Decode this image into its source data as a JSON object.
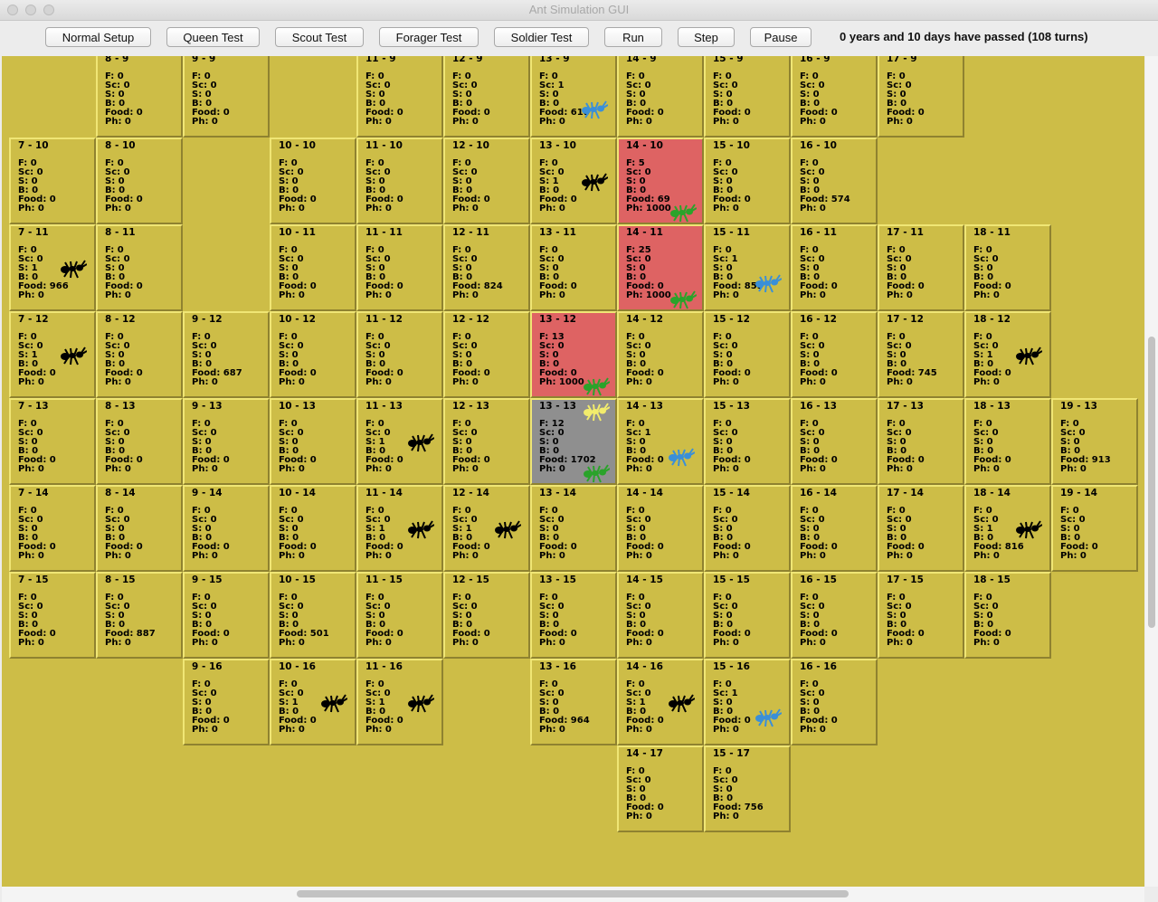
{
  "window": {
    "title": "Ant Simulation GUI"
  },
  "toolbar": {
    "buttons": [
      "Normal Setup",
      "Queen Test",
      "Scout Test",
      "Forager Test",
      "Soldier Test",
      "Run",
      "Step",
      "Pause"
    ],
    "status": "0 years and 10 days have passed (108 turns)"
  },
  "colors": {
    "board": "#cdbd47",
    "pheromone_cell": "#de6363",
    "colony_cell": "#8f8f8f",
    "soldier_ant": "#000000",
    "forager_ant": "#2aa32a",
    "scout_ant": "#3a8fd8",
    "queen_ant": "#f2ec6c"
  },
  "stat_labels": [
    "F: ",
    "Sc: ",
    "S: ",
    "B: ",
    "Food: ",
    "Ph: "
  ],
  "cells": [
    {
      "x": 8,
      "y": 9,
      "f": 0,
      "sc": 0,
      "s": 0,
      "b": 0,
      "food": 0,
      "ph": 0
    },
    {
      "x": 9,
      "y": 9,
      "f": 0,
      "sc": 0,
      "s": 0,
      "b": 0,
      "food": 0,
      "ph": 0
    },
    {
      "x": 11,
      "y": 9,
      "f": 0,
      "sc": 0,
      "s": 0,
      "b": 0,
      "food": 0,
      "ph": 0
    },
    {
      "x": 12,
      "y": 9,
      "f": 0,
      "sc": 0,
      "s": 0,
      "b": 0,
      "food": 0,
      "ph": 0
    },
    {
      "x": 13,
      "y": 9,
      "f": 0,
      "sc": 1,
      "s": 0,
      "b": 0,
      "food": 618,
      "ph": 0,
      "ants": [
        "scout"
      ]
    },
    {
      "x": 14,
      "y": 9,
      "f": 0,
      "sc": 0,
      "s": 0,
      "b": 0,
      "food": 0,
      "ph": 0
    },
    {
      "x": 15,
      "y": 9,
      "f": 0,
      "sc": 0,
      "s": 0,
      "b": 0,
      "food": 0,
      "ph": 0
    },
    {
      "x": 16,
      "y": 9,
      "f": 0,
      "sc": 0,
      "s": 0,
      "b": 0,
      "food": 0,
      "ph": 0
    },
    {
      "x": 17,
      "y": 9,
      "f": 0,
      "sc": 0,
      "s": 0,
      "b": 0,
      "food": 0,
      "ph": 0
    },
    {
      "x": 7,
      "y": 10,
      "f": 0,
      "sc": 0,
      "s": 0,
      "b": 0,
      "food": 0,
      "ph": 0
    },
    {
      "x": 8,
      "y": 10,
      "f": 0,
      "sc": 0,
      "s": 0,
      "b": 0,
      "food": 0,
      "ph": 0
    },
    {
      "x": 10,
      "y": 10,
      "f": 0,
      "sc": 0,
      "s": 0,
      "b": 0,
      "food": 0,
      "ph": 0
    },
    {
      "x": 11,
      "y": 10,
      "f": 0,
      "sc": 0,
      "s": 0,
      "b": 0,
      "food": 0,
      "ph": 0
    },
    {
      "x": 12,
      "y": 10,
      "f": 0,
      "sc": 0,
      "s": 0,
      "b": 0,
      "food": 0,
      "ph": 0
    },
    {
      "x": 13,
      "y": 10,
      "f": 0,
      "sc": 0,
      "s": 1,
      "b": 0,
      "food": 0,
      "ph": 0,
      "ants": [
        "soldier"
      ]
    },
    {
      "x": 14,
      "y": 10,
      "f": 5,
      "sc": 0,
      "s": 0,
      "b": 0,
      "food": 69,
      "ph": 1000,
      "ants": [
        "forager"
      ],
      "state": "hot"
    },
    {
      "x": 15,
      "y": 10,
      "f": 0,
      "sc": 0,
      "s": 0,
      "b": 0,
      "food": 0,
      "ph": 0
    },
    {
      "x": 16,
      "y": 10,
      "f": 0,
      "sc": 0,
      "s": 0,
      "b": 0,
      "food": 574,
      "ph": 0
    },
    {
      "x": 7,
      "y": 11,
      "f": 0,
      "sc": 0,
      "s": 1,
      "b": 0,
      "food": 966,
      "ph": 0,
      "ants": [
        "soldier"
      ]
    },
    {
      "x": 8,
      "y": 11,
      "f": 0,
      "sc": 0,
      "s": 0,
      "b": 0,
      "food": 0,
      "ph": 0
    },
    {
      "x": 10,
      "y": 11,
      "f": 0,
      "sc": 0,
      "s": 0,
      "b": 0,
      "food": 0,
      "ph": 0
    },
    {
      "x": 11,
      "y": 11,
      "f": 0,
      "sc": 0,
      "s": 0,
      "b": 0,
      "food": 0,
      "ph": 0
    },
    {
      "x": 12,
      "y": 11,
      "f": 0,
      "sc": 0,
      "s": 0,
      "b": 0,
      "food": 824,
      "ph": 0
    },
    {
      "x": 13,
      "y": 11,
      "f": 0,
      "sc": 0,
      "s": 0,
      "b": 0,
      "food": 0,
      "ph": 0
    },
    {
      "x": 14,
      "y": 11,
      "f": 25,
      "sc": 0,
      "s": 0,
      "b": 0,
      "food": 0,
      "ph": 1000,
      "ants": [
        "forager"
      ],
      "state": "hot"
    },
    {
      "x": 15,
      "y": 11,
      "f": 0,
      "sc": 1,
      "s": 0,
      "b": 0,
      "food": 855,
      "ph": 0,
      "ants": [
        "scout"
      ]
    },
    {
      "x": 16,
      "y": 11,
      "f": 0,
      "sc": 0,
      "s": 0,
      "b": 0,
      "food": 0,
      "ph": 0
    },
    {
      "x": 17,
      "y": 11,
      "f": 0,
      "sc": 0,
      "s": 0,
      "b": 0,
      "food": 0,
      "ph": 0
    },
    {
      "x": 18,
      "y": 11,
      "f": 0,
      "sc": 0,
      "s": 0,
      "b": 0,
      "food": 0,
      "ph": 0
    },
    {
      "x": 7,
      "y": 12,
      "f": 0,
      "sc": 0,
      "s": 1,
      "b": 0,
      "food": 0,
      "ph": 0,
      "ants": [
        "soldier"
      ]
    },
    {
      "x": 8,
      "y": 12,
      "f": 0,
      "sc": 0,
      "s": 0,
      "b": 0,
      "food": 0,
      "ph": 0
    },
    {
      "x": 9,
      "y": 12,
      "f": 0,
      "sc": 0,
      "s": 0,
      "b": 0,
      "food": 687,
      "ph": 0
    },
    {
      "x": 10,
      "y": 12,
      "f": 0,
      "sc": 0,
      "s": 0,
      "b": 0,
      "food": 0,
      "ph": 0
    },
    {
      "x": 11,
      "y": 12,
      "f": 0,
      "sc": 0,
      "s": 0,
      "b": 0,
      "food": 0,
      "ph": 0
    },
    {
      "x": 12,
      "y": 12,
      "f": 0,
      "sc": 0,
      "s": 0,
      "b": 0,
      "food": 0,
      "ph": 0
    },
    {
      "x": 13,
      "y": 12,
      "f": 13,
      "sc": 0,
      "s": 0,
      "b": 0,
      "food": 0,
      "ph": 1000,
      "ants": [
        "forager"
      ],
      "state": "hot"
    },
    {
      "x": 14,
      "y": 12,
      "f": 0,
      "sc": 0,
      "s": 0,
      "b": 0,
      "food": 0,
      "ph": 0
    },
    {
      "x": 15,
      "y": 12,
      "f": 0,
      "sc": 0,
      "s": 0,
      "b": 0,
      "food": 0,
      "ph": 0
    },
    {
      "x": 16,
      "y": 12,
      "f": 0,
      "sc": 0,
      "s": 0,
      "b": 0,
      "food": 0,
      "ph": 0
    },
    {
      "x": 17,
      "y": 12,
      "f": 0,
      "sc": 0,
      "s": 0,
      "b": 0,
      "food": 745,
      "ph": 0
    },
    {
      "x": 18,
      "y": 12,
      "f": 0,
      "sc": 0,
      "s": 1,
      "b": 0,
      "food": 0,
      "ph": 0,
      "ants": [
        "soldier"
      ]
    },
    {
      "x": 7,
      "y": 13,
      "f": 0,
      "sc": 0,
      "s": 0,
      "b": 0,
      "food": 0,
      "ph": 0
    },
    {
      "x": 8,
      "y": 13,
      "f": 0,
      "sc": 0,
      "s": 0,
      "b": 0,
      "food": 0,
      "ph": 0
    },
    {
      "x": 9,
      "y": 13,
      "f": 0,
      "sc": 0,
      "s": 0,
      "b": 0,
      "food": 0,
      "ph": 0
    },
    {
      "x": 10,
      "y": 13,
      "f": 0,
      "sc": 0,
      "s": 0,
      "b": 0,
      "food": 0,
      "ph": 0
    },
    {
      "x": 11,
      "y": 13,
      "f": 0,
      "sc": 0,
      "s": 1,
      "b": 0,
      "food": 0,
      "ph": 0,
      "ants": [
        "soldier"
      ]
    },
    {
      "x": 12,
      "y": 13,
      "f": 0,
      "sc": 0,
      "s": 0,
      "b": 0,
      "food": 0,
      "ph": 0
    },
    {
      "x": 13,
      "y": 13,
      "f": 12,
      "sc": 0,
      "s": 0,
      "b": 0,
      "food": 1702,
      "ph": 0,
      "ants": [
        "queen",
        "forager"
      ],
      "state": "home"
    },
    {
      "x": 14,
      "y": 13,
      "f": 0,
      "sc": 1,
      "s": 0,
      "b": 0,
      "food": 0,
      "ph": 0,
      "ants": [
        "scout"
      ]
    },
    {
      "x": 15,
      "y": 13,
      "f": 0,
      "sc": 0,
      "s": 0,
      "b": 0,
      "food": 0,
      "ph": 0
    },
    {
      "x": 16,
      "y": 13,
      "f": 0,
      "sc": 0,
      "s": 0,
      "b": 0,
      "food": 0,
      "ph": 0
    },
    {
      "x": 17,
      "y": 13,
      "f": 0,
      "sc": 0,
      "s": 0,
      "b": 0,
      "food": 0,
      "ph": 0
    },
    {
      "x": 18,
      "y": 13,
      "f": 0,
      "sc": 0,
      "s": 0,
      "b": 0,
      "food": 0,
      "ph": 0
    },
    {
      "x": 19,
      "y": 13,
      "f": 0,
      "sc": 0,
      "s": 0,
      "b": 0,
      "food": 913,
      "ph": 0
    },
    {
      "x": 7,
      "y": 14,
      "f": 0,
      "sc": 0,
      "s": 0,
      "b": 0,
      "food": 0,
      "ph": 0
    },
    {
      "x": 8,
      "y": 14,
      "f": 0,
      "sc": 0,
      "s": 0,
      "b": 0,
      "food": 0,
      "ph": 0
    },
    {
      "x": 9,
      "y": 14,
      "f": 0,
      "sc": 0,
      "s": 0,
      "b": 0,
      "food": 0,
      "ph": 0
    },
    {
      "x": 10,
      "y": 14,
      "f": 0,
      "sc": 0,
      "s": 0,
      "b": 0,
      "food": 0,
      "ph": 0
    },
    {
      "x": 11,
      "y": 14,
      "f": 0,
      "sc": 0,
      "s": 1,
      "b": 0,
      "food": 0,
      "ph": 0,
      "ants": [
        "soldier"
      ]
    },
    {
      "x": 12,
      "y": 14,
      "f": 0,
      "sc": 0,
      "s": 1,
      "b": 0,
      "food": 0,
      "ph": 0,
      "ants": [
        "soldier"
      ]
    },
    {
      "x": 13,
      "y": 14,
      "f": 0,
      "sc": 0,
      "s": 0,
      "b": 0,
      "food": 0,
      "ph": 0
    },
    {
      "x": 14,
      "y": 14,
      "f": 0,
      "sc": 0,
      "s": 0,
      "b": 0,
      "food": 0,
      "ph": 0
    },
    {
      "x": 15,
      "y": 14,
      "f": 0,
      "sc": 0,
      "s": 0,
      "b": 0,
      "food": 0,
      "ph": 0
    },
    {
      "x": 16,
      "y": 14,
      "f": 0,
      "sc": 0,
      "s": 0,
      "b": 0,
      "food": 0,
      "ph": 0
    },
    {
      "x": 17,
      "y": 14,
      "f": 0,
      "sc": 0,
      "s": 0,
      "b": 0,
      "food": 0,
      "ph": 0
    },
    {
      "x": 18,
      "y": 14,
      "f": 0,
      "sc": 0,
      "s": 1,
      "b": 0,
      "food": 816,
      "ph": 0,
      "ants": [
        "soldier"
      ]
    },
    {
      "x": 19,
      "y": 14,
      "f": 0,
      "sc": 0,
      "s": 0,
      "b": 0,
      "food": 0,
      "ph": 0
    },
    {
      "x": 7,
      "y": 15,
      "f": 0,
      "sc": 0,
      "s": 0,
      "b": 0,
      "food": 0,
      "ph": 0
    },
    {
      "x": 8,
      "y": 15,
      "f": 0,
      "sc": 0,
      "s": 0,
      "b": 0,
      "food": 887,
      "ph": 0
    },
    {
      "x": 9,
      "y": 15,
      "f": 0,
      "sc": 0,
      "s": 0,
      "b": 0,
      "food": 0,
      "ph": 0
    },
    {
      "x": 10,
      "y": 15,
      "f": 0,
      "sc": 0,
      "s": 0,
      "b": 0,
      "food": 501,
      "ph": 0
    },
    {
      "x": 11,
      "y": 15,
      "f": 0,
      "sc": 0,
      "s": 0,
      "b": 0,
      "food": 0,
      "ph": 0
    },
    {
      "x": 12,
      "y": 15,
      "f": 0,
      "sc": 0,
      "s": 0,
      "b": 0,
      "food": 0,
      "ph": 0
    },
    {
      "x": 13,
      "y": 15,
      "f": 0,
      "sc": 0,
      "s": 0,
      "b": 0,
      "food": 0,
      "ph": 0
    },
    {
      "x": 14,
      "y": 15,
      "f": 0,
      "sc": 0,
      "s": 0,
      "b": 0,
      "food": 0,
      "ph": 0
    },
    {
      "x": 15,
      "y": 15,
      "f": 0,
      "sc": 0,
      "s": 0,
      "b": 0,
      "food": 0,
      "ph": 0
    },
    {
      "x": 16,
      "y": 15,
      "f": 0,
      "sc": 0,
      "s": 0,
      "b": 0,
      "food": 0,
      "ph": 0
    },
    {
      "x": 17,
      "y": 15,
      "f": 0,
      "sc": 0,
      "s": 0,
      "b": 0,
      "food": 0,
      "ph": 0
    },
    {
      "x": 18,
      "y": 15,
      "f": 0,
      "sc": 0,
      "s": 0,
      "b": 0,
      "food": 0,
      "ph": 0
    },
    {
      "x": 9,
      "y": 16,
      "f": 0,
      "sc": 0,
      "s": 0,
      "b": 0,
      "food": 0,
      "ph": 0
    },
    {
      "x": 10,
      "y": 16,
      "f": 0,
      "sc": 0,
      "s": 1,
      "b": 0,
      "food": 0,
      "ph": 0,
      "ants": [
        "soldier"
      ]
    },
    {
      "x": 11,
      "y": 16,
      "f": 0,
      "sc": 0,
      "s": 1,
      "b": 0,
      "food": 0,
      "ph": 0,
      "ants": [
        "soldier"
      ]
    },
    {
      "x": 13,
      "y": 16,
      "f": 0,
      "sc": 0,
      "s": 0,
      "b": 0,
      "food": 964,
      "ph": 0
    },
    {
      "x": 14,
      "y": 16,
      "f": 0,
      "sc": 0,
      "s": 1,
      "b": 0,
      "food": 0,
      "ph": 0,
      "ants": [
        "soldier"
      ]
    },
    {
      "x": 15,
      "y": 16,
      "f": 0,
      "sc": 1,
      "s": 0,
      "b": 0,
      "food": 0,
      "ph": 0,
      "ants": [
        "scout"
      ]
    },
    {
      "x": 16,
      "y": 16,
      "f": 0,
      "sc": 0,
      "s": 0,
      "b": 0,
      "food": 0,
      "ph": 0
    },
    {
      "x": 14,
      "y": 17,
      "f": 0,
      "sc": 0,
      "s": 0,
      "b": 0,
      "food": 0,
      "ph": 0
    },
    {
      "x": 15,
      "y": 17,
      "f": 0,
      "sc": 0,
      "s": 0,
      "b": 0,
      "food": 756,
      "ph": 0
    }
  ]
}
